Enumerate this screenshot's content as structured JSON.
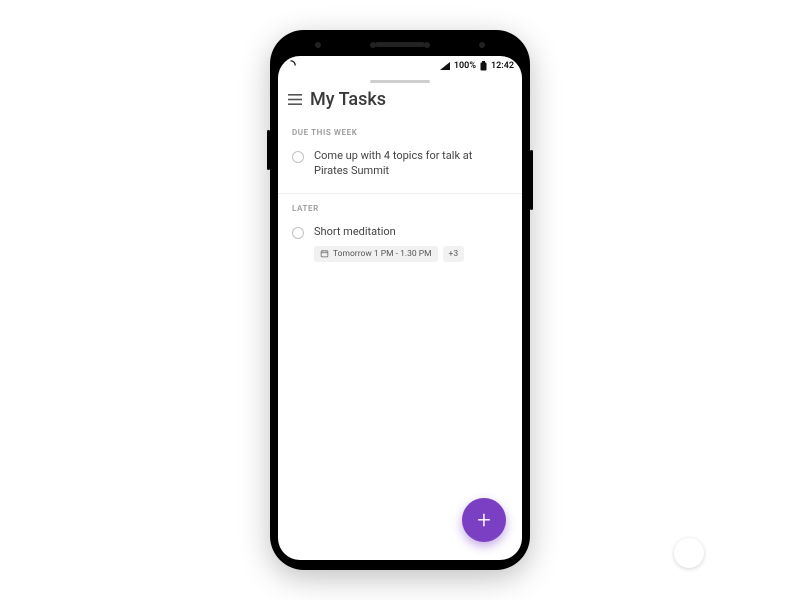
{
  "status": {
    "battery_text": "100%",
    "time": "12:42"
  },
  "header": {
    "title": "My Tasks"
  },
  "sections": [
    {
      "label": "DUE THIS WEEK",
      "tasks": [
        {
          "title": "Come up with 4 topics for talk at Pirates Summit"
        }
      ]
    },
    {
      "label": "LATER",
      "tasks": [
        {
          "title": "Short meditation",
          "schedule_chip": "Tomorrow 1 PM - 1.30 PM",
          "extra_chip": "+3"
        }
      ]
    }
  ],
  "fab": {
    "glyph": "+"
  },
  "colors": {
    "accent": "#7b3fc4"
  }
}
